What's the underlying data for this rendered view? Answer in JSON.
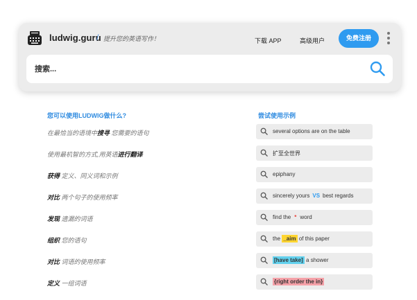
{
  "header": {
    "brand": "ludwig.guru",
    "separator": "/",
    "tagline": "提升您的英语写作！",
    "nav": {
      "download_app": "下载 APP",
      "pro_user": "高级用户",
      "signup": "免费注册"
    }
  },
  "search": {
    "placeholder": "搜索..."
  },
  "features": {
    "heading": "您可以使用LUDWIG做什么?",
    "items": [
      {
        "pre": "在最恰当的语境中",
        "bold": "搜寻",
        "post": " 您需要的语句"
      },
      {
        "pre": "使用最机智的方式,用英语",
        "bold": "进行翻译",
        "post": ""
      },
      {
        "pre": "",
        "bold": "获得",
        "post": " 定义、同义词和示例"
      },
      {
        "pre": "",
        "bold": "对比",
        "post": " 两个句子的使用频率"
      },
      {
        "pre": "",
        "bold": "发现",
        "post": " 遗漏的词语"
      },
      {
        "pre": "",
        "bold": "组织",
        "post": " 您的语句"
      },
      {
        "pre": "",
        "bold": "对比",
        "post": " 词语的使用频率"
      },
      {
        "pre": "",
        "bold": "定义",
        "post": " 一组词语"
      }
    ]
  },
  "examples": {
    "heading": "尝试使用示例",
    "items": [
      {
        "text": "several options are on the table"
      },
      {
        "text": "扩至全世界"
      },
      {
        "text": "epiphany"
      },
      {
        "a": "sincerely yours",
        "vs": "VS",
        "b": "best regards"
      },
      {
        "a": "find the",
        "star": "*",
        "b": "word"
      },
      {
        "a": "the",
        "hl": "_aim",
        "b": "of this paper"
      },
      {
        "hl": "[have take]",
        "b": "a shower"
      },
      {
        "hl": "{right order the in}"
      }
    ]
  },
  "colors": {
    "accent": "#2f9bf0",
    "heading": "#2f8be0",
    "card_bg": "#ececec",
    "highlight_yellow": "#ffd531",
    "highlight_cyan": "#62d1ee",
    "highlight_pink": "#f5a1a8",
    "wildcard_red": "#e8433c"
  },
  "icons": [
    "typewriter-logo-icon",
    "more-vertical-icon",
    "search-icon",
    "magnifier-icon"
  ]
}
